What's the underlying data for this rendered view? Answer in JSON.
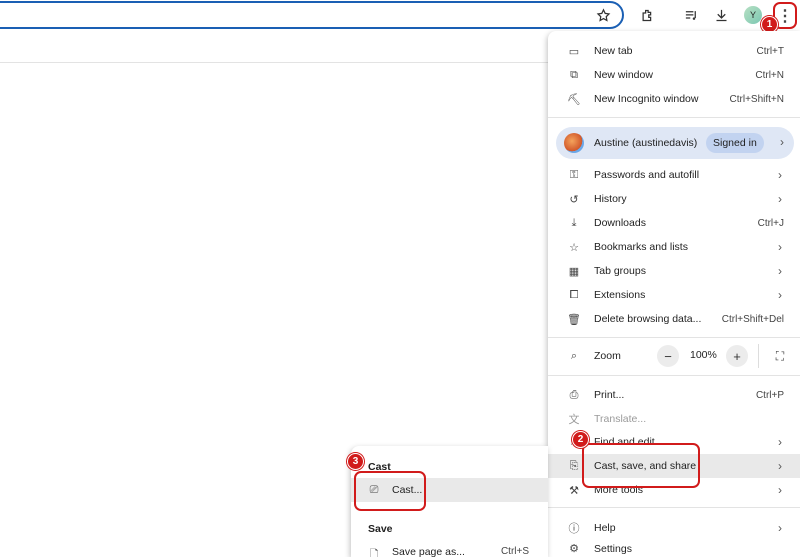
{
  "toolbar": {
    "icons": [
      "star-icon",
      "extensions-icon",
      "reading-list-icon",
      "download-icon",
      "profile-avatar",
      "kebab-menu-icon"
    ],
    "avatar_letter": "Y"
  },
  "badges": {
    "one": "1",
    "two": "2",
    "three": "3"
  },
  "menu": {
    "new_tab": {
      "label": "New tab",
      "shortcut": "Ctrl+T"
    },
    "new_window": {
      "label": "New window",
      "shortcut": "Ctrl+N"
    },
    "new_incognito": {
      "label": "New Incognito window",
      "shortcut": "Ctrl+Shift+N"
    },
    "profile": {
      "name": "Austine (austinedavis)",
      "status": "Signed in"
    },
    "passwords": {
      "label": "Passwords and autofill"
    },
    "history": {
      "label": "History"
    },
    "downloads": {
      "label": "Downloads",
      "shortcut": "Ctrl+J"
    },
    "bookmarks": {
      "label": "Bookmarks and lists"
    },
    "tab_groups": {
      "label": "Tab groups"
    },
    "extensions": {
      "label": "Extensions"
    },
    "delete_data": {
      "label": "Delete browsing data...",
      "shortcut": "Ctrl+Shift+Del"
    },
    "zoom": {
      "label": "Zoom",
      "value": "100%",
      "minus": "−",
      "plus": "+"
    },
    "print": {
      "label": "Print...",
      "shortcut": "Ctrl+P"
    },
    "translate": {
      "label": "Translate..."
    },
    "find_edit": {
      "label": "Find and edit"
    },
    "cast_save_share": {
      "label": "Cast, save, and share"
    },
    "more_tools": {
      "label": "More tools"
    },
    "help": {
      "label": "Help"
    },
    "settings": {
      "label": "Settings"
    }
  },
  "submenu": {
    "cast_header": "Cast",
    "cast": {
      "label": "Cast..."
    },
    "save_header": "Save",
    "save_page": {
      "label": "Save page as...",
      "shortcut": "Ctrl+S"
    }
  },
  "colors": {
    "accent": "#1a5fb4",
    "highlight_red": "#d11b1b",
    "profile_bg": "#dfe7f5"
  }
}
